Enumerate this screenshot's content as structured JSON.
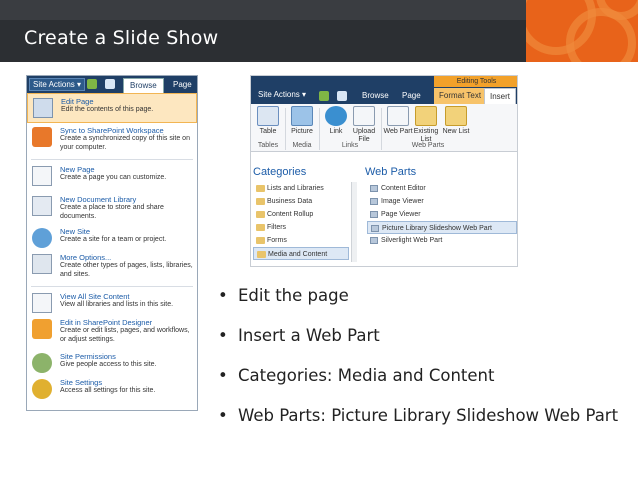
{
  "slide": {
    "title": "Create a Slide Show",
    "bullets": [
      "Edit the page",
      "Insert a Web Part",
      "Categories:  Media and Content",
      "Web Parts:  Picture Library Slideshow Web Part"
    ]
  },
  "site_actions_menu": {
    "button": "Site Actions ▾",
    "tabs": [
      "Browse",
      "Page"
    ],
    "items": [
      {
        "title": "Edit Page",
        "desc": "Edit the contents of this page.",
        "icon": "edit-page-icon"
      },
      {
        "title": "Sync to SharePoint Workspace",
        "desc": "Create a synchronized copy of this site on your computer.",
        "icon": "sync-workspace-icon"
      },
      {
        "title": "New Page",
        "desc": "Create a page you can customize.",
        "icon": "new-page-icon"
      },
      {
        "title": "New Document Library",
        "desc": "Create a place to store and share documents.",
        "icon": "doc-library-icon"
      },
      {
        "title": "New Site",
        "desc": "Create a site for a team or project.",
        "icon": "new-site-icon"
      },
      {
        "title": "More Options...",
        "desc": "Create other types of pages, lists, libraries, and sites.",
        "icon": "more-options-icon"
      },
      {
        "title": "View All Site Content",
        "desc": "View all libraries and lists in this site.",
        "icon": "view-content-icon"
      },
      {
        "title": "Edit in SharePoint Designer",
        "desc": "Create or edit lists, pages, and workflows, or adjust settings.",
        "icon": "designer-icon"
      },
      {
        "title": "Site Permissions",
        "desc": "Give people access to this site.",
        "icon": "permissions-icon"
      },
      {
        "title": "Site Settings",
        "desc": "Access all settings for this site.",
        "icon": "settings-icon"
      }
    ]
  },
  "ribbon": {
    "editing_tools": "Editing Tools",
    "site_actions": "Site Actions ▾",
    "tabs": [
      "Browse",
      "Page",
      "Format Text",
      "Insert"
    ],
    "buttons": [
      {
        "label": "Table",
        "icon": "table-icon"
      },
      {
        "label": "Picture",
        "icon": "picture-icon"
      },
      {
        "label": "Link",
        "icon": "link-icon"
      },
      {
        "label": "Upload File",
        "icon": "upload-icon"
      },
      {
        "label": "Web Part",
        "icon": "web-part-icon"
      },
      {
        "label": "Existing List",
        "icon": "existing-list-icon"
      },
      {
        "label": "New List",
        "icon": "new-list-icon"
      }
    ],
    "groups": [
      "Tables",
      "Media",
      "Links",
      "Web Parts"
    ],
    "categories_heading": "Categories",
    "webparts_heading": "Web Parts",
    "categories": [
      "Lists and Libraries",
      "Business Data",
      "Content Rollup",
      "Filters",
      "Forms",
      "Media and Content"
    ],
    "web_parts": [
      "Content Editor",
      "Image Viewer",
      "Page Viewer",
      "Picture Library Slideshow Web Part",
      "Silverlight Web Part"
    ]
  }
}
